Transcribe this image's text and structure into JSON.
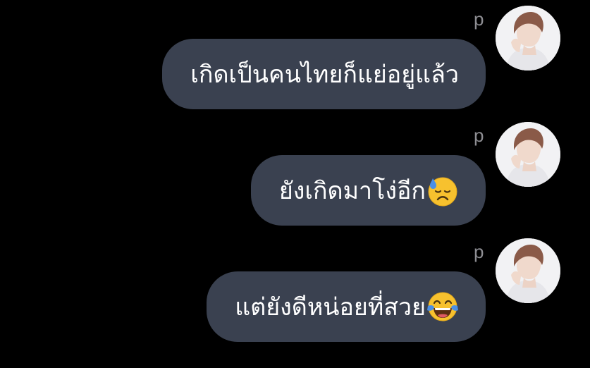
{
  "chat": {
    "messages": [
      {
        "sender": "p",
        "text": "เกิดเป็นคนไทยก็แย่อยู่แล้ว",
        "emoji": ""
      },
      {
        "sender": "p",
        "text": "ยังเกิดมาโง่อีก",
        "emoji": "downcast-face-with-sweat"
      },
      {
        "sender": "p",
        "text": "แต่ยังดีหน่อยที่สวย",
        "emoji": "face-with-tears-of-joy"
      }
    ]
  },
  "colors": {
    "background": "#000000",
    "bubble": "#3a4150",
    "bubble_text": "#ffffff",
    "sender_name": "#8e8e93"
  }
}
